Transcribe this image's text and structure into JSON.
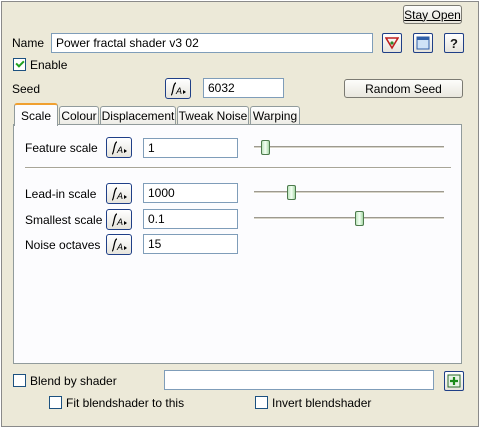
{
  "stay_open_label": "Stay Open",
  "name_label": "Name",
  "name_value": "Power fractal shader v3 02",
  "enable_label": "Enable",
  "enable_checked": true,
  "seed_label": "Seed",
  "seed_value": "6032",
  "random_seed_label": "Random Seed",
  "tabs": [
    {
      "label": "Scale",
      "active": true
    },
    {
      "label": "Colour",
      "active": false
    },
    {
      "label": "Displacement",
      "active": false
    },
    {
      "label": "Tweak Noise",
      "active": false
    },
    {
      "label": "Warping",
      "active": false
    }
  ],
  "scale": {
    "feature_scale": {
      "label": "Feature scale",
      "value": "1",
      "slider_fraction": 0.04
    },
    "lead_in_scale": {
      "label": "Lead-in scale",
      "value": "1000",
      "slider_fraction": 0.18
    },
    "smallest_scale": {
      "label": "Smallest scale",
      "value": "0.1",
      "slider_fraction": 0.56
    },
    "noise_octaves": {
      "label": "Noise octaves",
      "value": "15"
    }
  },
  "blend": {
    "blend_by_shader_label": "Blend by shader",
    "blend_shader_value": "",
    "fit_blendshader_label": "Fit blendshader to this",
    "invert_blendshader_label": "Invert blendshader"
  },
  "icons": {
    "function": "function-icon",
    "shader_tree": "shader-tree-icon",
    "window": "window-icon",
    "help": "help-icon",
    "add": "add-icon"
  },
  "help_glyph": "?"
}
